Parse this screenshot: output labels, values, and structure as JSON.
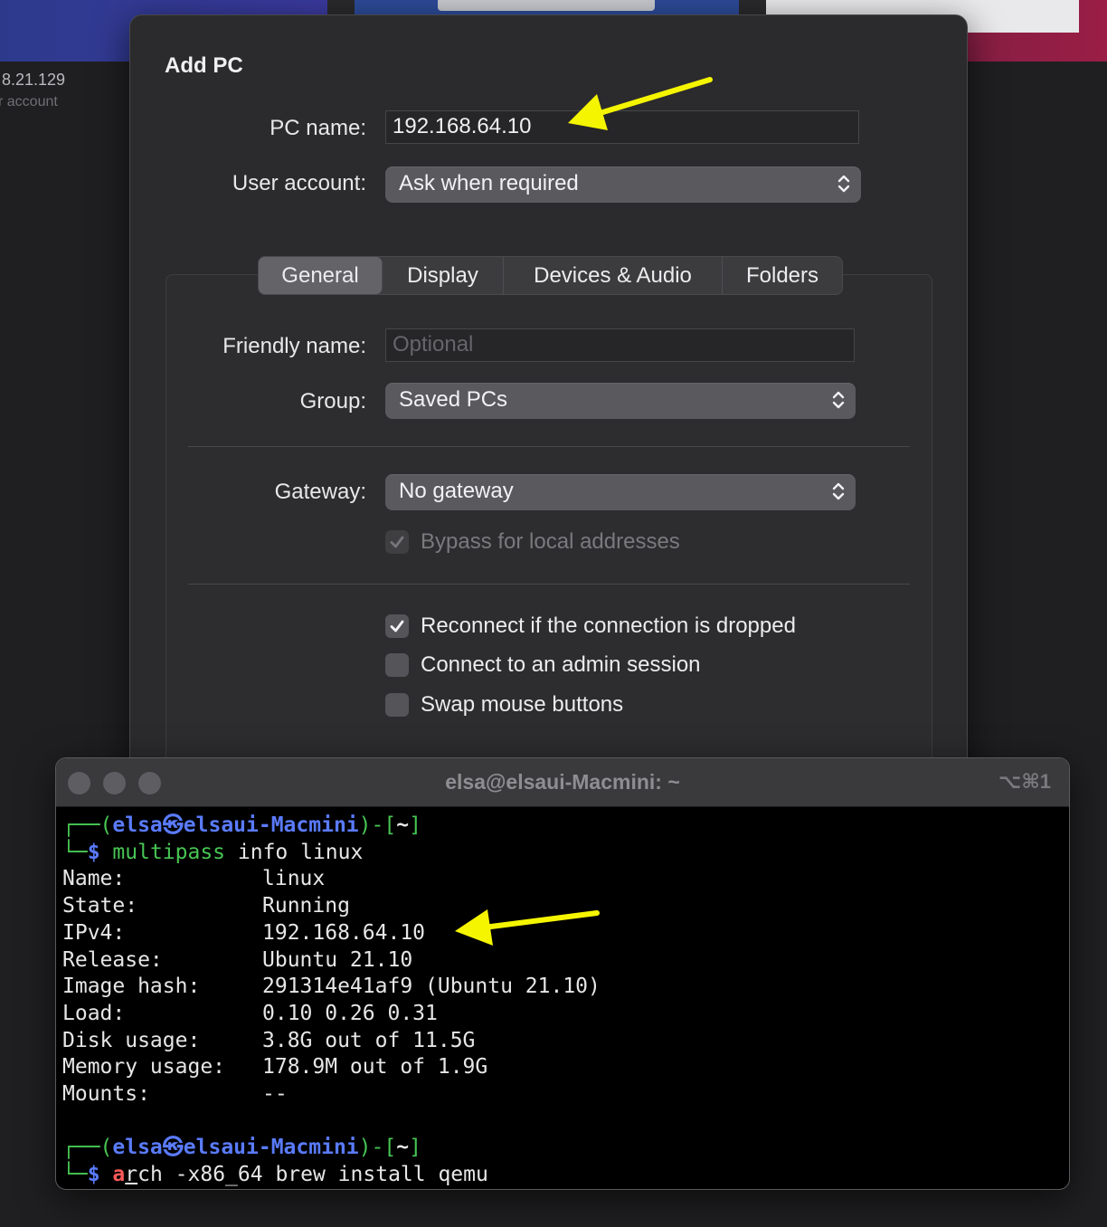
{
  "background": {
    "ip_fragment": "8.21.129",
    "account_fragment": "r account"
  },
  "dialog": {
    "title": "Add PC",
    "pc_name": {
      "label": "PC name:",
      "value": "192.168.64.10"
    },
    "user_account": {
      "label": "User account:",
      "value": "Ask when required"
    },
    "tabs": [
      {
        "label": "General",
        "active": true
      },
      {
        "label": "Display",
        "active": false
      },
      {
        "label": "Devices & Audio",
        "active": false
      },
      {
        "label": "Folders",
        "active": false
      }
    ],
    "friendly_name": {
      "label": "Friendly name:",
      "value": "",
      "placeholder": "Optional"
    },
    "group": {
      "label": "Group:",
      "value": "Saved PCs"
    },
    "gateway": {
      "label": "Gateway:",
      "value": "No gateway"
    },
    "bypass": {
      "label": "Bypass for local addresses",
      "checked": true,
      "enabled": false
    },
    "options": [
      {
        "label": "Reconnect if the connection is dropped",
        "checked": true
      },
      {
        "label": "Connect to an admin session",
        "checked": false
      },
      {
        "label": "Swap mouse buttons",
        "checked": false
      }
    ]
  },
  "terminal": {
    "title": "elsa@elsaui-Macmini: ~",
    "shortcut": "⌥⌘1",
    "prompt": {
      "user": "elsa",
      "host": "elsaui-Macmini",
      "dir": "~",
      "separator_glyph": "㉿"
    },
    "command1": {
      "cmd": "multipass",
      "args": " info linux"
    },
    "info": [
      {
        "key": "Name:",
        "value": "linux"
      },
      {
        "key": "State:",
        "value": "Running"
      },
      {
        "key": "IPv4:",
        "value": "192.168.64.10"
      },
      {
        "key": "Release:",
        "value": "Ubuntu 21.10"
      },
      {
        "key": "Image hash:",
        "value": "291314e41af9 (Ubuntu 21.10)"
      },
      {
        "key": "Load:",
        "value": "0.10 0.26 0.31"
      },
      {
        "key": "Disk usage:",
        "value": "3.8G out of 11.5G"
      },
      {
        "key": "Memory usage:",
        "value": "178.9M out of 1.9G"
      },
      {
        "key": "Mounts:",
        "value": "--"
      }
    ],
    "command2": {
      "typed": "a",
      "cursor_char": "r",
      "rest": "ch -x86_64 brew install qemu"
    }
  },
  "annotations": {
    "arrow_color": "#f5f500"
  }
}
